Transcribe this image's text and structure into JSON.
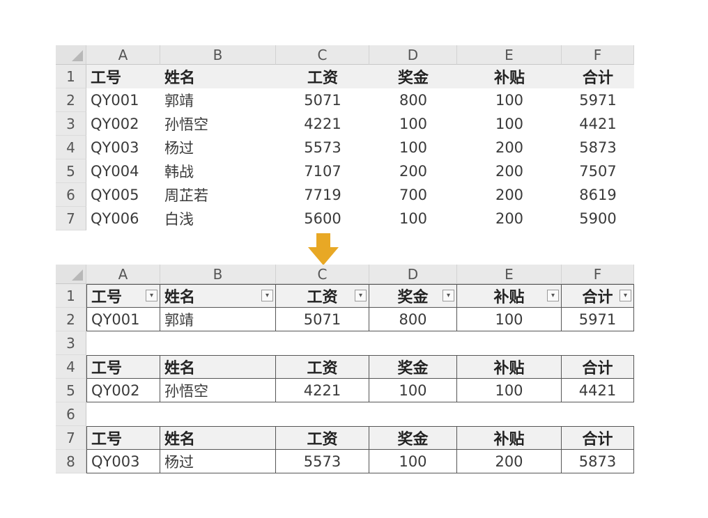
{
  "columns": [
    "A",
    "B",
    "C",
    "D",
    "E",
    "F"
  ],
  "sheet1": {
    "row_numbers": [
      "1",
      "2",
      "3",
      "4",
      "5",
      "6",
      "7"
    ],
    "header": [
      "工号",
      "姓名",
      "工资",
      "奖金",
      "补贴",
      "合计"
    ],
    "rows": [
      [
        "QY001",
        "郭靖",
        "5071",
        "800",
        "100",
        "5971"
      ],
      [
        "QY002",
        "孙悟空",
        "4221",
        "100",
        "100",
        "4421"
      ],
      [
        "QY003",
        "杨过",
        "5573",
        "100",
        "200",
        "5873"
      ],
      [
        "QY004",
        "韩战",
        "7107",
        "200",
        "200",
        "7507"
      ],
      [
        "QY005",
        "周芷若",
        "7719",
        "700",
        "200",
        "8619"
      ],
      [
        "QY006",
        "白浅",
        "5600",
        "100",
        "200",
        "5900"
      ]
    ]
  },
  "sheet2": {
    "row_numbers": [
      "1",
      "2",
      "3",
      "4",
      "5",
      "6",
      "7",
      "8"
    ],
    "header": [
      "工号",
      "姓名",
      "工资",
      "奖金",
      "补贴",
      "合计"
    ],
    "filter_icon": "dropdown-arrow-icon",
    "rows": [
      [
        "QY001",
        "郭靖",
        "5071",
        "800",
        "100",
        "5971"
      ],
      [
        "QY002",
        "孙悟空",
        "4221",
        "100",
        "100",
        "4421"
      ],
      [
        "QY003",
        "杨过",
        "5573",
        "100",
        "200",
        "5873"
      ]
    ]
  },
  "arrow_icon": "down-arrow-icon",
  "colors": {
    "arrow": "#e8a825",
    "grid_header": "#e9e9e9",
    "border": "#555555"
  }
}
